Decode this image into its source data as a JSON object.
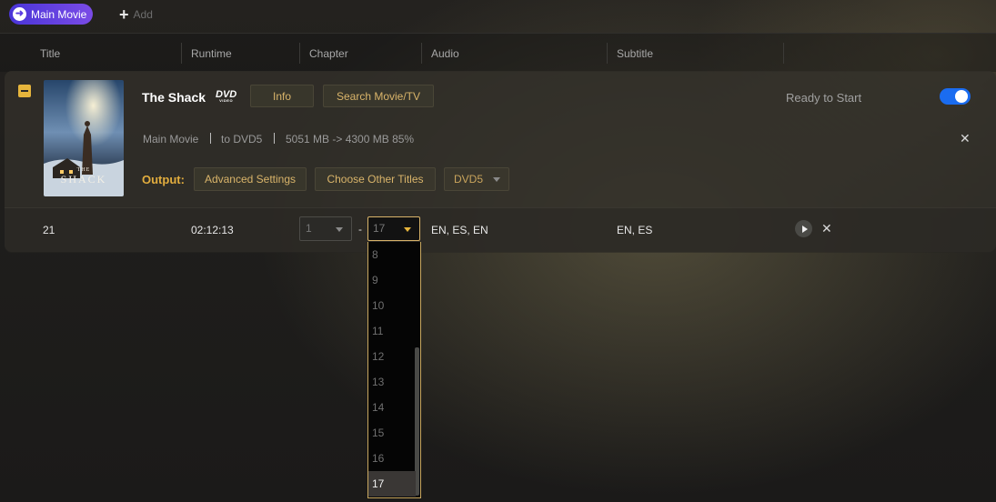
{
  "topbar": {
    "main_movie_label": "Main Movie",
    "add_label": "Add"
  },
  "columns": {
    "title": "Title",
    "runtime": "Runtime",
    "chapter": "Chapter",
    "audio": "Audio",
    "subtitle": "Subtitle"
  },
  "movie": {
    "title": "The Shack",
    "disc_logo": "DVD",
    "disc_logo_sub": "VIDEO",
    "poster_title_line1": "THE",
    "poster_title_line2": "SHACK",
    "info_label": "Info",
    "search_label": "Search Movie/TV",
    "status": "Ready to Start",
    "toggle_on": true,
    "meta": {
      "mode": "Main Movie",
      "target": "to DVD5",
      "size": "5051 MB -> 4300 MB 85%"
    },
    "output_label": "Output:",
    "advanced_settings_label": "Advanced Settings",
    "choose_other_titles_label": "Choose Other Titles",
    "output_format": "DVD5"
  },
  "title_row": {
    "number": "21",
    "runtime": "02:12:13",
    "chapter_start": "1",
    "chapter_dash": "-",
    "chapter_end": "17",
    "audio": "EN, ES, EN",
    "subtitle": "EN, ES"
  },
  "chapter_dropdown": {
    "options": [
      "8",
      "9",
      "10",
      "11",
      "12",
      "13",
      "14",
      "15",
      "16",
      "17"
    ],
    "selected": "17"
  },
  "colors": {
    "accent_gold": "#e2ad3e",
    "toggle_blue": "#1a6cf0",
    "main_movie_purple": "#6a43e2"
  }
}
